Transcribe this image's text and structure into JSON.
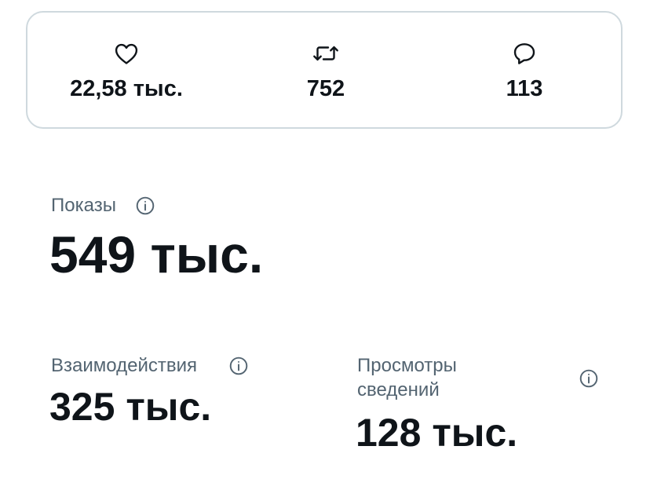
{
  "engagement": {
    "likes": {
      "icon": "heart-icon",
      "value": "22,58 тыс."
    },
    "reposts": {
      "icon": "repost-icon",
      "value": "752"
    },
    "replies": {
      "icon": "reply-icon",
      "value": "113"
    }
  },
  "impressions": {
    "label": "Показы",
    "value": "549 тыс.",
    "info_icon": "info-icon"
  },
  "engagements": {
    "label": "Взаимодействия",
    "value": "325 тыс.",
    "info_icon": "info-icon"
  },
  "detail_expands": {
    "label_line1": "Просмотры",
    "label_line2": "сведений",
    "value": "128 тыс.",
    "info_icon": "info-icon"
  },
  "colors": {
    "text_primary": "#0f1419",
    "text_secondary": "#536471",
    "border": "#cfd9de"
  }
}
